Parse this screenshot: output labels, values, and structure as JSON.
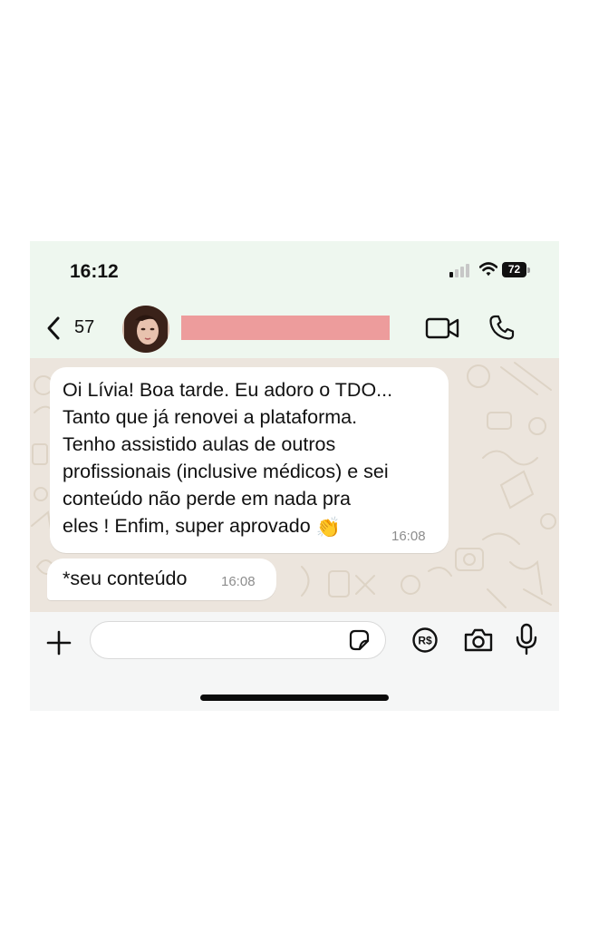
{
  "status_bar": {
    "time": "16:12",
    "battery": "72"
  },
  "header": {
    "back_count": "57"
  },
  "messages": [
    {
      "text": "Oi Lívia! Boa tarde. Eu adoro o TDO...\nTanto que já renovei a plataforma.\nTenho assistido aulas de outros\nprofissionais (inclusive médicos) e sei\nconteúdo não perde em nada pra\neles ! Enfim, super aprovado",
      "emoji": "👏",
      "time": "16:08"
    },
    {
      "text": "*seu conteúdo",
      "time": "16:08"
    }
  ],
  "composer": {
    "value": ""
  },
  "icons": {
    "back": "chevron-left-icon",
    "avatar": "contact-avatar",
    "video": "video-camera-icon",
    "call": "phone-icon",
    "plus": "plus-icon",
    "sticker": "sticker-icon",
    "pay": "payment-rs-icon",
    "camera": "camera-icon",
    "mic": "microphone-icon"
  },
  "colors": {
    "chat_background": "#ece5dd",
    "header_background": "#eef7ef",
    "bubble": "#ffffff",
    "redaction": "#ed9c9c"
  }
}
